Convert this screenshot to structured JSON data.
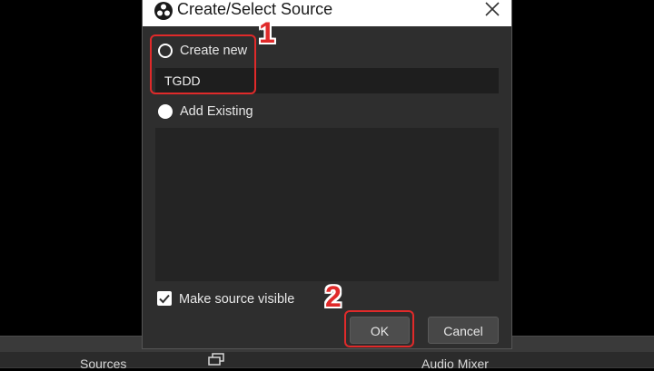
{
  "dialog": {
    "title": "Create/Select Source",
    "create_new_label": "Create new",
    "name_value": "TGDD",
    "add_existing_label": "Add Existing",
    "make_visible_label": "Make source visible",
    "make_visible_checked": true,
    "ok_label": "OK",
    "cancel_label": "Cancel"
  },
  "annotations": {
    "step1": "1",
    "step2": "2",
    "color": "#e02a2a"
  },
  "background_panels": {
    "sources_label": "Sources",
    "audio_mixer_label": "Audio Mixer"
  },
  "icons": {
    "title_logo": "obs-logo-icon",
    "close": "close-icon",
    "checkmark": "checkmark-icon",
    "dock": "dock-window-icon"
  }
}
